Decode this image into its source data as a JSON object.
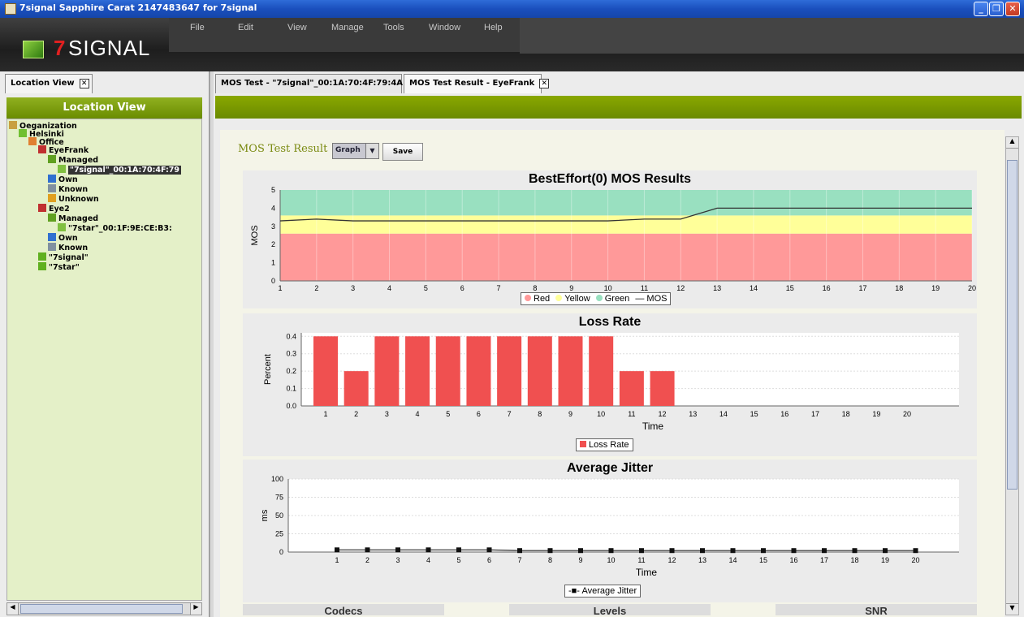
{
  "window": {
    "title": "7signal Sapphire Carat  2147483647 for 7signal"
  },
  "logo": {
    "seven": "7",
    "word": "SIGNAL"
  },
  "menu": [
    "File",
    "Edit",
    "View",
    "Manage",
    "Tools",
    "Window",
    "Help"
  ],
  "left_tab": {
    "label": "Location View"
  },
  "location_view": {
    "title": "Location View"
  },
  "tree": [
    {
      "label": "Oeganization",
      "icon": "folder-icon"
    },
    {
      "label": "Helsinki",
      "icon": "globe-icon"
    },
    {
      "label": "Office",
      "icon": "building-icon"
    },
    {
      "label": "EyeFrank",
      "icon": "eye-device-icon"
    },
    {
      "label": "Managed",
      "icon": "ap-managed-icon"
    },
    {
      "label": "\"7signal\"_00:1A:70:4F:79",
      "icon": "ap-icon"
    },
    {
      "label": "Own",
      "icon": "ap-own-icon"
    },
    {
      "label": "Known",
      "icon": "ap-known-icon"
    },
    {
      "label": "Unknown",
      "icon": "ap-unknown-icon"
    },
    {
      "label": "Eye2",
      "icon": "eye-device-icon"
    },
    {
      "label": "Managed",
      "icon": "ap-managed-icon"
    },
    {
      "label": "\"7star\"_00:1F:9E:CE:B3:",
      "icon": "ap-icon"
    },
    {
      "label": "Own",
      "icon": "ap-own-icon"
    },
    {
      "label": "Known",
      "icon": "ap-known-icon"
    },
    {
      "label": "\"7signal\"",
      "icon": "ssid-icon"
    },
    {
      "label": "\"7star\"",
      "icon": "ssid-icon"
    }
  ],
  "tabs": [
    {
      "label": "MOS Test - \"7signal\"_00:1A:70:4F:79:4A"
    },
    {
      "label": "MOS Test Result - EyeFrank"
    }
  ],
  "result": {
    "title": "MOS Test Result",
    "view_select": "Graph",
    "save_label": "Save"
  },
  "bottom_panels": [
    "Codecs",
    "Levels",
    "SNR"
  ],
  "colors": {
    "red_zone": "#ff9999",
    "yellow_zone": "#ffff99",
    "green_zone": "#99e0c0",
    "bar": "#f05050",
    "accent": "#7a9a00"
  },
  "chart_data": [
    {
      "type": "line",
      "title": "BestEffort(0) MOS Results",
      "xlabel": "",
      "ylabel": "MOS",
      "x": [
        1,
        2,
        3,
        4,
        5,
        6,
        7,
        8,
        9,
        10,
        11,
        12,
        13,
        14,
        15,
        16,
        17,
        18,
        19,
        20
      ],
      "ylim": [
        0,
        5
      ],
      "bands": [
        {
          "name": "Red",
          "from": 0,
          "to": 2.6,
          "color": "#ff9999"
        },
        {
          "name": "Yellow",
          "from": 2.6,
          "to": 3.6,
          "color": "#ffff99"
        },
        {
          "name": "Green",
          "from": 3.6,
          "to": 5,
          "color": "#99e0c0"
        }
      ],
      "series": [
        {
          "name": "MOS",
          "values": [
            3.3,
            3.4,
            3.3,
            3.3,
            3.3,
            3.3,
            3.3,
            3.3,
            3.3,
            3.3,
            3.4,
            3.4,
            4.0,
            4.0,
            4.0,
            4.0,
            4.0,
            4.0,
            4.0,
            4.0
          ]
        }
      ],
      "legend": [
        "Red",
        "Yellow",
        "Green",
        "MOS"
      ],
      "xticks": [
        "1",
        "2",
        "3",
        "4",
        "5",
        "6",
        "7",
        "8",
        "9",
        "10",
        "11",
        "12",
        "13",
        "14",
        "15",
        "16",
        "17",
        "18",
        "19",
        "20"
      ],
      "yticks": [
        "0",
        "1",
        "2",
        "3",
        "4",
        "5"
      ]
    },
    {
      "type": "bar",
      "title": "Loss Rate",
      "xlabel": "Time",
      "ylabel": "Percent",
      "categories": [
        "1",
        "2",
        "3",
        "4",
        "5",
        "6",
        "7",
        "8",
        "9",
        "10",
        "11",
        "12",
        "13",
        "14",
        "15",
        "16",
        "17",
        "18",
        "19",
        "20"
      ],
      "series": [
        {
          "name": "Loss Rate",
          "values": [
            0.4,
            0.2,
            0.4,
            0.4,
            0.4,
            0.4,
            0.4,
            0.4,
            0.4,
            0.4,
            0.2,
            0.2,
            0,
            0,
            0,
            0,
            0,
            0,
            0,
            0
          ]
        }
      ],
      "ylim": [
        0,
        0.42
      ],
      "yticks": [
        "0.0",
        "0.1",
        "0.2",
        "0.3",
        "0.4"
      ],
      "legend": [
        "Loss Rate"
      ]
    },
    {
      "type": "line",
      "title": "Average Jitter",
      "xlabel": "Time",
      "ylabel": "ms",
      "categories": [
        "1",
        "2",
        "3",
        "4",
        "5",
        "6",
        "7",
        "8",
        "9",
        "10",
        "11",
        "12",
        "13",
        "14",
        "15",
        "16",
        "17",
        "18",
        "19",
        "20"
      ],
      "series": [
        {
          "name": "Average Jitter",
          "values": [
            3,
            3,
            3,
            3,
            3,
            3,
            2,
            2,
            2,
            2,
            2,
            2,
            2,
            2,
            2,
            2,
            2,
            2,
            2,
            2
          ]
        }
      ],
      "ylim": [
        0,
        100
      ],
      "yticks": [
        "0",
        "25",
        "50",
        "75",
        "100"
      ],
      "legend": [
        "Average Jitter"
      ]
    }
  ]
}
